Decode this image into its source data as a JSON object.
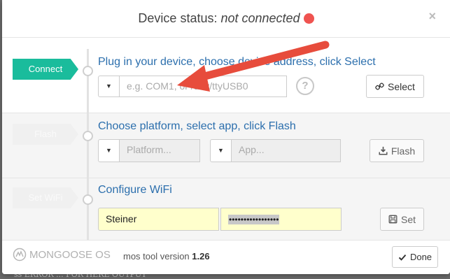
{
  "header": {
    "title_prefix": "Device status: ",
    "title_status": "not connected",
    "status_color": "#ef5350",
    "close_glyph": "×"
  },
  "steps": [
    {
      "tag": "Connect",
      "title": "Plug in your device, choose device address, click Select",
      "port_placeholder": "e.g. COM1, or /dev/ttyUSB0",
      "help_glyph": "?",
      "button_label": "Select",
      "button_icon": "link-icon"
    },
    {
      "tag": "Flash",
      "title": "Choose platform, select app, click Flash",
      "platform_placeholder": "Platform...",
      "app_placeholder": "App...",
      "button_label": "Flash",
      "button_icon": "download-icon"
    },
    {
      "tag": "Set WiFi",
      "title": "Configure WiFi",
      "ssid_value": "Steiner",
      "password_value": "•••••••••••••••••",
      "button_label": "Set",
      "button_icon": "save-icon"
    }
  ],
  "footer": {
    "logo_text": "MONGOOSE OS",
    "version_prefix": "mos tool version ",
    "version_number": "1.26",
    "done_label": "Done",
    "done_icon": "check-icon"
  },
  "accent_color": "#1abc9c",
  "annotation_arrow_color": "#e74c3c",
  "background_partial_text": "ss ERROR ... FOR HERE OUTPUT"
}
